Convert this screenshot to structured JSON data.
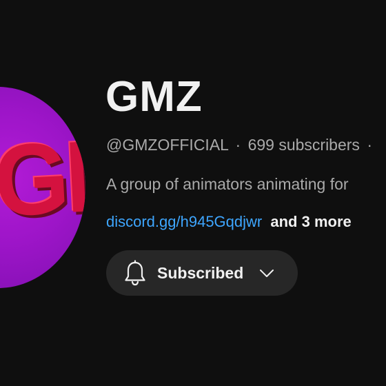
{
  "channel": {
    "avatar_text": "GMZ",
    "name": "GMZ",
    "handle": "@GMZOFFICIAL",
    "separator": "·",
    "subscribers": "699 subscribers",
    "trailing_separator": "·",
    "description": "A group of animators animating for",
    "link": "discord.gg/h945Gqdjwr",
    "more_links": "and 3 more"
  },
  "subscribe_button": {
    "label": "Subscribed",
    "icon": "bell-icon",
    "dropdown_icon": "chevron-down-icon"
  },
  "colors": {
    "background": "#0f0f0f",
    "avatar": "#9d15c8",
    "avatar_letters": "#d4123f",
    "link": "#3ea6ff",
    "button_bg": "#272727",
    "primary_text": "#f1f1f1",
    "secondary_text": "#aaaaaa"
  }
}
